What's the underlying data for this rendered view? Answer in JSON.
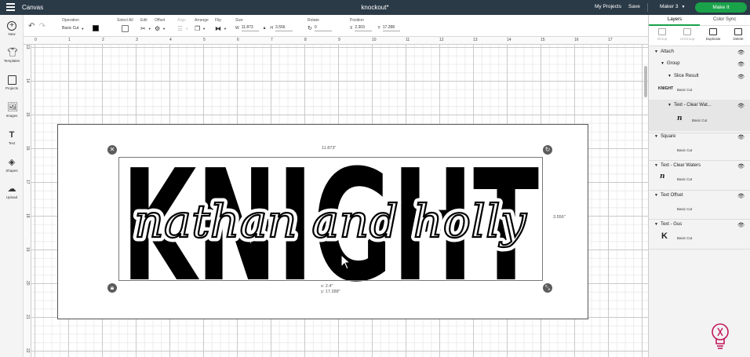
{
  "topbar": {
    "app_title": "Canvas",
    "doc_title": "knockout*",
    "my_projects": "My Projects",
    "save": "Save",
    "machine": "Maker 3",
    "make_it": "Make It"
  },
  "toolbar": {
    "operation_label": "Operation",
    "operation_value": "Basic Cut",
    "select_all_label": "Select All",
    "edit_label": "Edit",
    "offset_label": "Offset",
    "align_label": "Align",
    "arrange_label": "Arrange",
    "flip_label": "Flip",
    "size_label": "Size",
    "size_w_label": "W",
    "size_w": "11.873",
    "size_h_label": "H",
    "size_h": "3.556",
    "rotate_label": "Rotate",
    "rotate_value": "0",
    "position_label": "Position",
    "pos_x_label": "X",
    "pos_x": "2.303",
    "pos_y_label": "Y",
    "pos_y": "17.288"
  },
  "leftbar": {
    "items": [
      {
        "label": "New",
        "icon": "plus-circle-icon"
      },
      {
        "label": "Templates",
        "icon": "shirt-icon"
      },
      {
        "label": "Projects",
        "icon": "projects-icon"
      },
      {
        "label": "Images",
        "icon": "image-icon"
      },
      {
        "label": "Text",
        "icon": "text-icon"
      },
      {
        "label": "Shapes",
        "icon": "shapes-icon"
      },
      {
        "label": "Upload",
        "icon": "upload-icon"
      }
    ]
  },
  "ruler": {
    "top": [
      "0",
      "1",
      "2",
      "3",
      "4",
      "5",
      "6",
      "7",
      "8",
      "9",
      "10",
      "11",
      "12",
      "13",
      "14",
      "15",
      "16",
      "17"
    ],
    "left": [
      "13",
      "14",
      "15",
      "16",
      "17",
      "18",
      "19",
      "20",
      "21",
      "22"
    ]
  },
  "canvas": {
    "width_dim": "11.873\"",
    "height_dim": "3.556\"",
    "pos_x": "x: 2.4\"",
    "pos_y": "y: 17.288\"",
    "design_main_text": "KNIGHT",
    "design_script_text": "nathan and holly"
  },
  "panel": {
    "tabs": [
      "Layers",
      "Color Sync"
    ],
    "actions": [
      {
        "label": "Group",
        "enabled": false
      },
      {
        "label": "UnGroup",
        "enabled": false
      },
      {
        "label": "Duplicate",
        "enabled": true
      },
      {
        "label": "Delete",
        "enabled": true
      }
    ],
    "layers": {
      "attach": "Attach",
      "group": "Group",
      "slice_result": "Slice Result",
      "slice_result_sub": "Basic Cut",
      "slice_thumb": "KNIGHT",
      "text_clear_water": "Text - Clear Wat...",
      "text_clear_water_sub": "Basic Cut",
      "text_clear_water_thumb": "n",
      "square": "Square",
      "square_sub": "Basic Cut",
      "text_clear_waters": "Text - Clear Waters",
      "text_clear_waters_sub": "Basic Cut",
      "text_clear_waters_thumb": "n",
      "text_offset": "Text Offset",
      "text_offset_sub": "Basic Cut",
      "text_gus": "Text - Gus",
      "text_gus_sub": "Basic Cut",
      "text_gus_thumb": "K"
    }
  },
  "colors": {
    "topbar": "#2b3a47",
    "accent": "#1aa24a"
  }
}
